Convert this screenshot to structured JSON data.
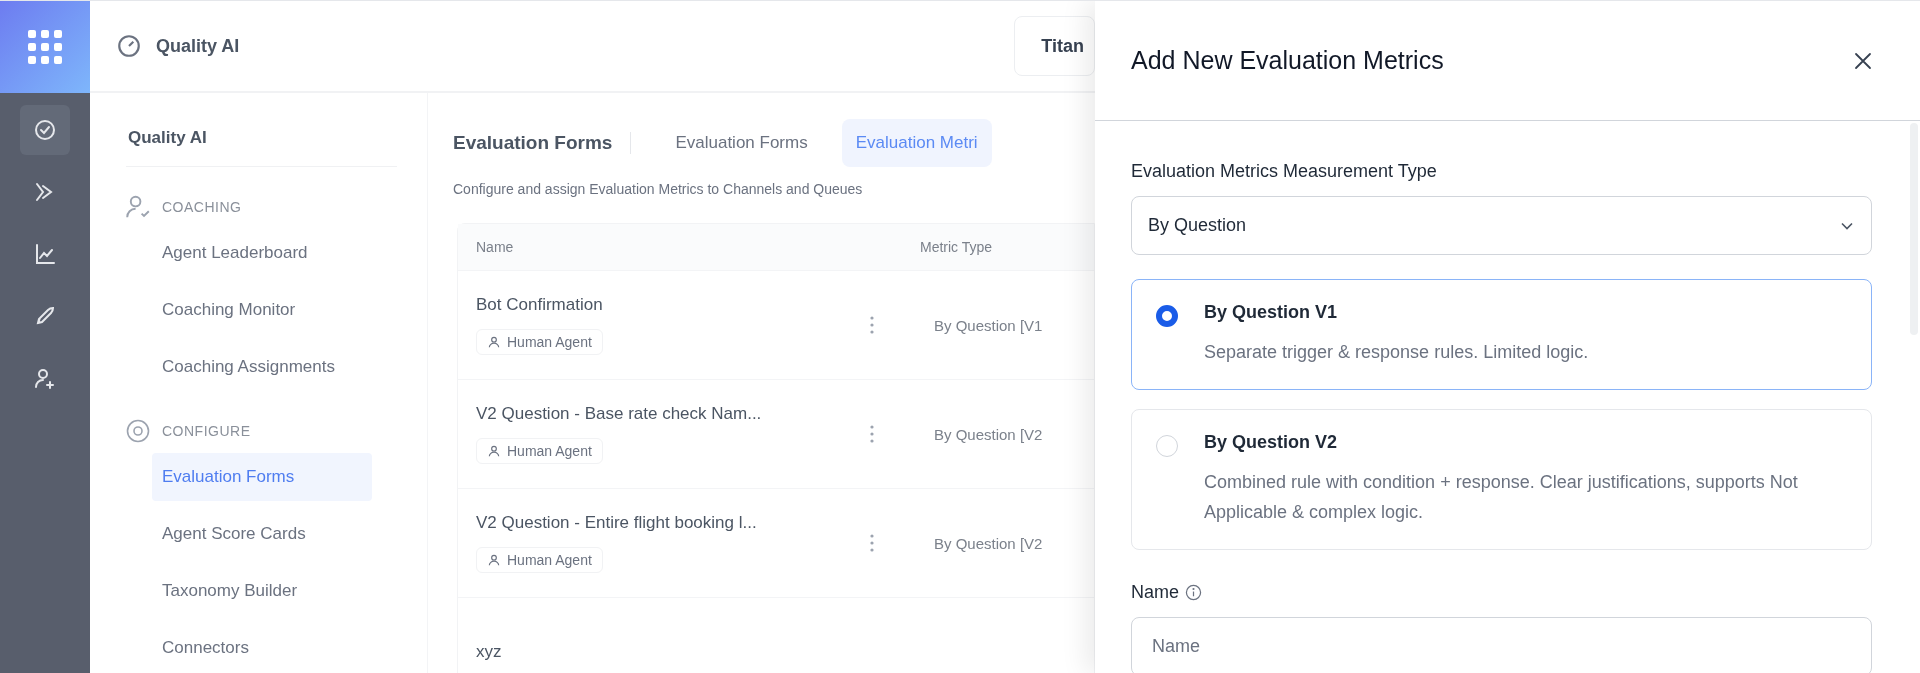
{
  "rail": {
    "items": [
      {
        "selected": true
      },
      {
        "selected": false
      },
      {
        "selected": false
      },
      {
        "selected": false
      },
      {
        "selected": false
      }
    ]
  },
  "header": {
    "app_name": "Quality AI",
    "button": "Titan"
  },
  "sidebar": {
    "title": "Quality AI",
    "sections": [
      {
        "heading": "COACHING",
        "items": [
          {
            "label": "Agent Leaderboard",
            "selected": false
          },
          {
            "label": "Coaching Monitor",
            "selected": false
          },
          {
            "label": "Coaching Assignments",
            "selected": false
          }
        ]
      },
      {
        "heading": "CONFIGURE",
        "items": [
          {
            "label": "Evaluation Forms",
            "selected": true
          },
          {
            "label": "Agent Score Cards",
            "selected": false
          },
          {
            "label": "Taxonomy Builder",
            "selected": false
          },
          {
            "label": "Connectors",
            "selected": false
          }
        ]
      }
    ]
  },
  "main": {
    "title": "Evaluation Forms",
    "tabs": [
      {
        "label": "Evaluation Forms",
        "selected": false
      },
      {
        "label": "Evaluation Metri",
        "selected": true
      }
    ],
    "description": "Configure and assign Evaluation Metrics to Channels and Queues",
    "table": {
      "columns": [
        "Name",
        "Metric Type"
      ],
      "rows": [
        {
          "name": "Bot Confirmation",
          "tag": "Human Agent",
          "metric_type": "By Question [V1"
        },
        {
          "name": "V2 Question - Base rate check Nam...",
          "tag": "Human Agent",
          "metric_type": "By Question [V2"
        },
        {
          "name": "V2 Question - Entire flight booking l...",
          "tag": "Human Agent",
          "metric_type": "By Question [V2"
        },
        {
          "name": "xyz"
        }
      ]
    }
  },
  "drawer": {
    "title": "Add New Evaluation Metrics",
    "type_field": {
      "label": "Evaluation Metrics Measurement Type",
      "value": "By Question"
    },
    "options": [
      {
        "title": "By Question V1",
        "description": "Separate trigger & response rules. Limited logic.",
        "selected": true
      },
      {
        "title": "By Question V2",
        "description": "Combined rule with condition + response. Clear justifications, supports Not Applicable & complex logic.",
        "selected": false
      }
    ],
    "name_field": {
      "label": "Name",
      "placeholder": "Name"
    }
  }
}
